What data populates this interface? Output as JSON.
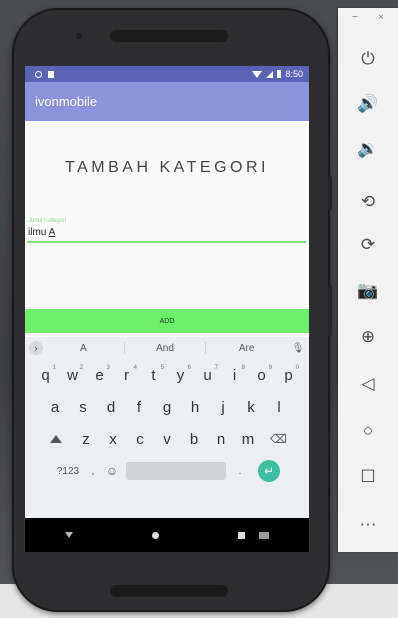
{
  "app": {
    "name": "ivonmobile"
  },
  "status_bar": {
    "time": "8:50"
  },
  "page": {
    "title": "TAMBAH KATEGORI"
  },
  "form": {
    "field_label": "Judul Kategori",
    "field_value_prefix": "ilmu ",
    "field_value_cursor": "A",
    "add_button": "ADD"
  },
  "keyboard": {
    "suggestions": [
      "A",
      "And",
      "Are"
    ],
    "row1": [
      {
        "char": "q",
        "hint": "1"
      },
      {
        "char": "w",
        "hint": "2"
      },
      {
        "char": "e",
        "hint": "3"
      },
      {
        "char": "r",
        "hint": "4"
      },
      {
        "char": "t",
        "hint": "5"
      },
      {
        "char": "y",
        "hint": "6"
      },
      {
        "char": "u",
        "hint": "7"
      },
      {
        "char": "i",
        "hint": "8"
      },
      {
        "char": "o",
        "hint": "9"
      },
      {
        "char": "p",
        "hint": "0"
      }
    ],
    "row2": [
      "a",
      "s",
      "d",
      "f",
      "g",
      "h",
      "j",
      "k",
      "l"
    ],
    "row3": [
      "z",
      "x",
      "c",
      "v",
      "b",
      "n",
      "m"
    ],
    "symbols_key": "?123",
    "comma_key": ",",
    "emoji_key": "☺",
    "period_key": ".",
    "enter_key": "↵",
    "backspace_key": "⌫",
    "mic_key": "🎙"
  },
  "emulator_panel": {
    "minimize": "−",
    "close": "×",
    "tools": [
      {
        "icon": "power-icon",
        "glyph": "⏻"
      },
      {
        "icon": "volume-up-icon",
        "glyph": "🔊"
      },
      {
        "icon": "volume-down-icon",
        "glyph": "🔉"
      },
      {
        "icon": "rotate-left-icon",
        "glyph": "⟲"
      },
      {
        "icon": "rotate-right-icon",
        "glyph": "⟳"
      },
      {
        "icon": "camera-icon",
        "glyph": "📷"
      },
      {
        "icon": "zoom-icon",
        "glyph": "⊕"
      },
      {
        "icon": "back-icon",
        "glyph": "◁"
      },
      {
        "icon": "home-icon",
        "glyph": "○"
      },
      {
        "icon": "overview-icon",
        "glyph": "☐"
      },
      {
        "icon": "more-icon",
        "glyph": "···"
      }
    ]
  },
  "colors": {
    "status_bar": "#5a64b7",
    "app_bar": "#8a93dc",
    "add_button": "#6ef06c",
    "field_accent": "#7ddf7a",
    "enter_key": "#3fbf9f"
  }
}
